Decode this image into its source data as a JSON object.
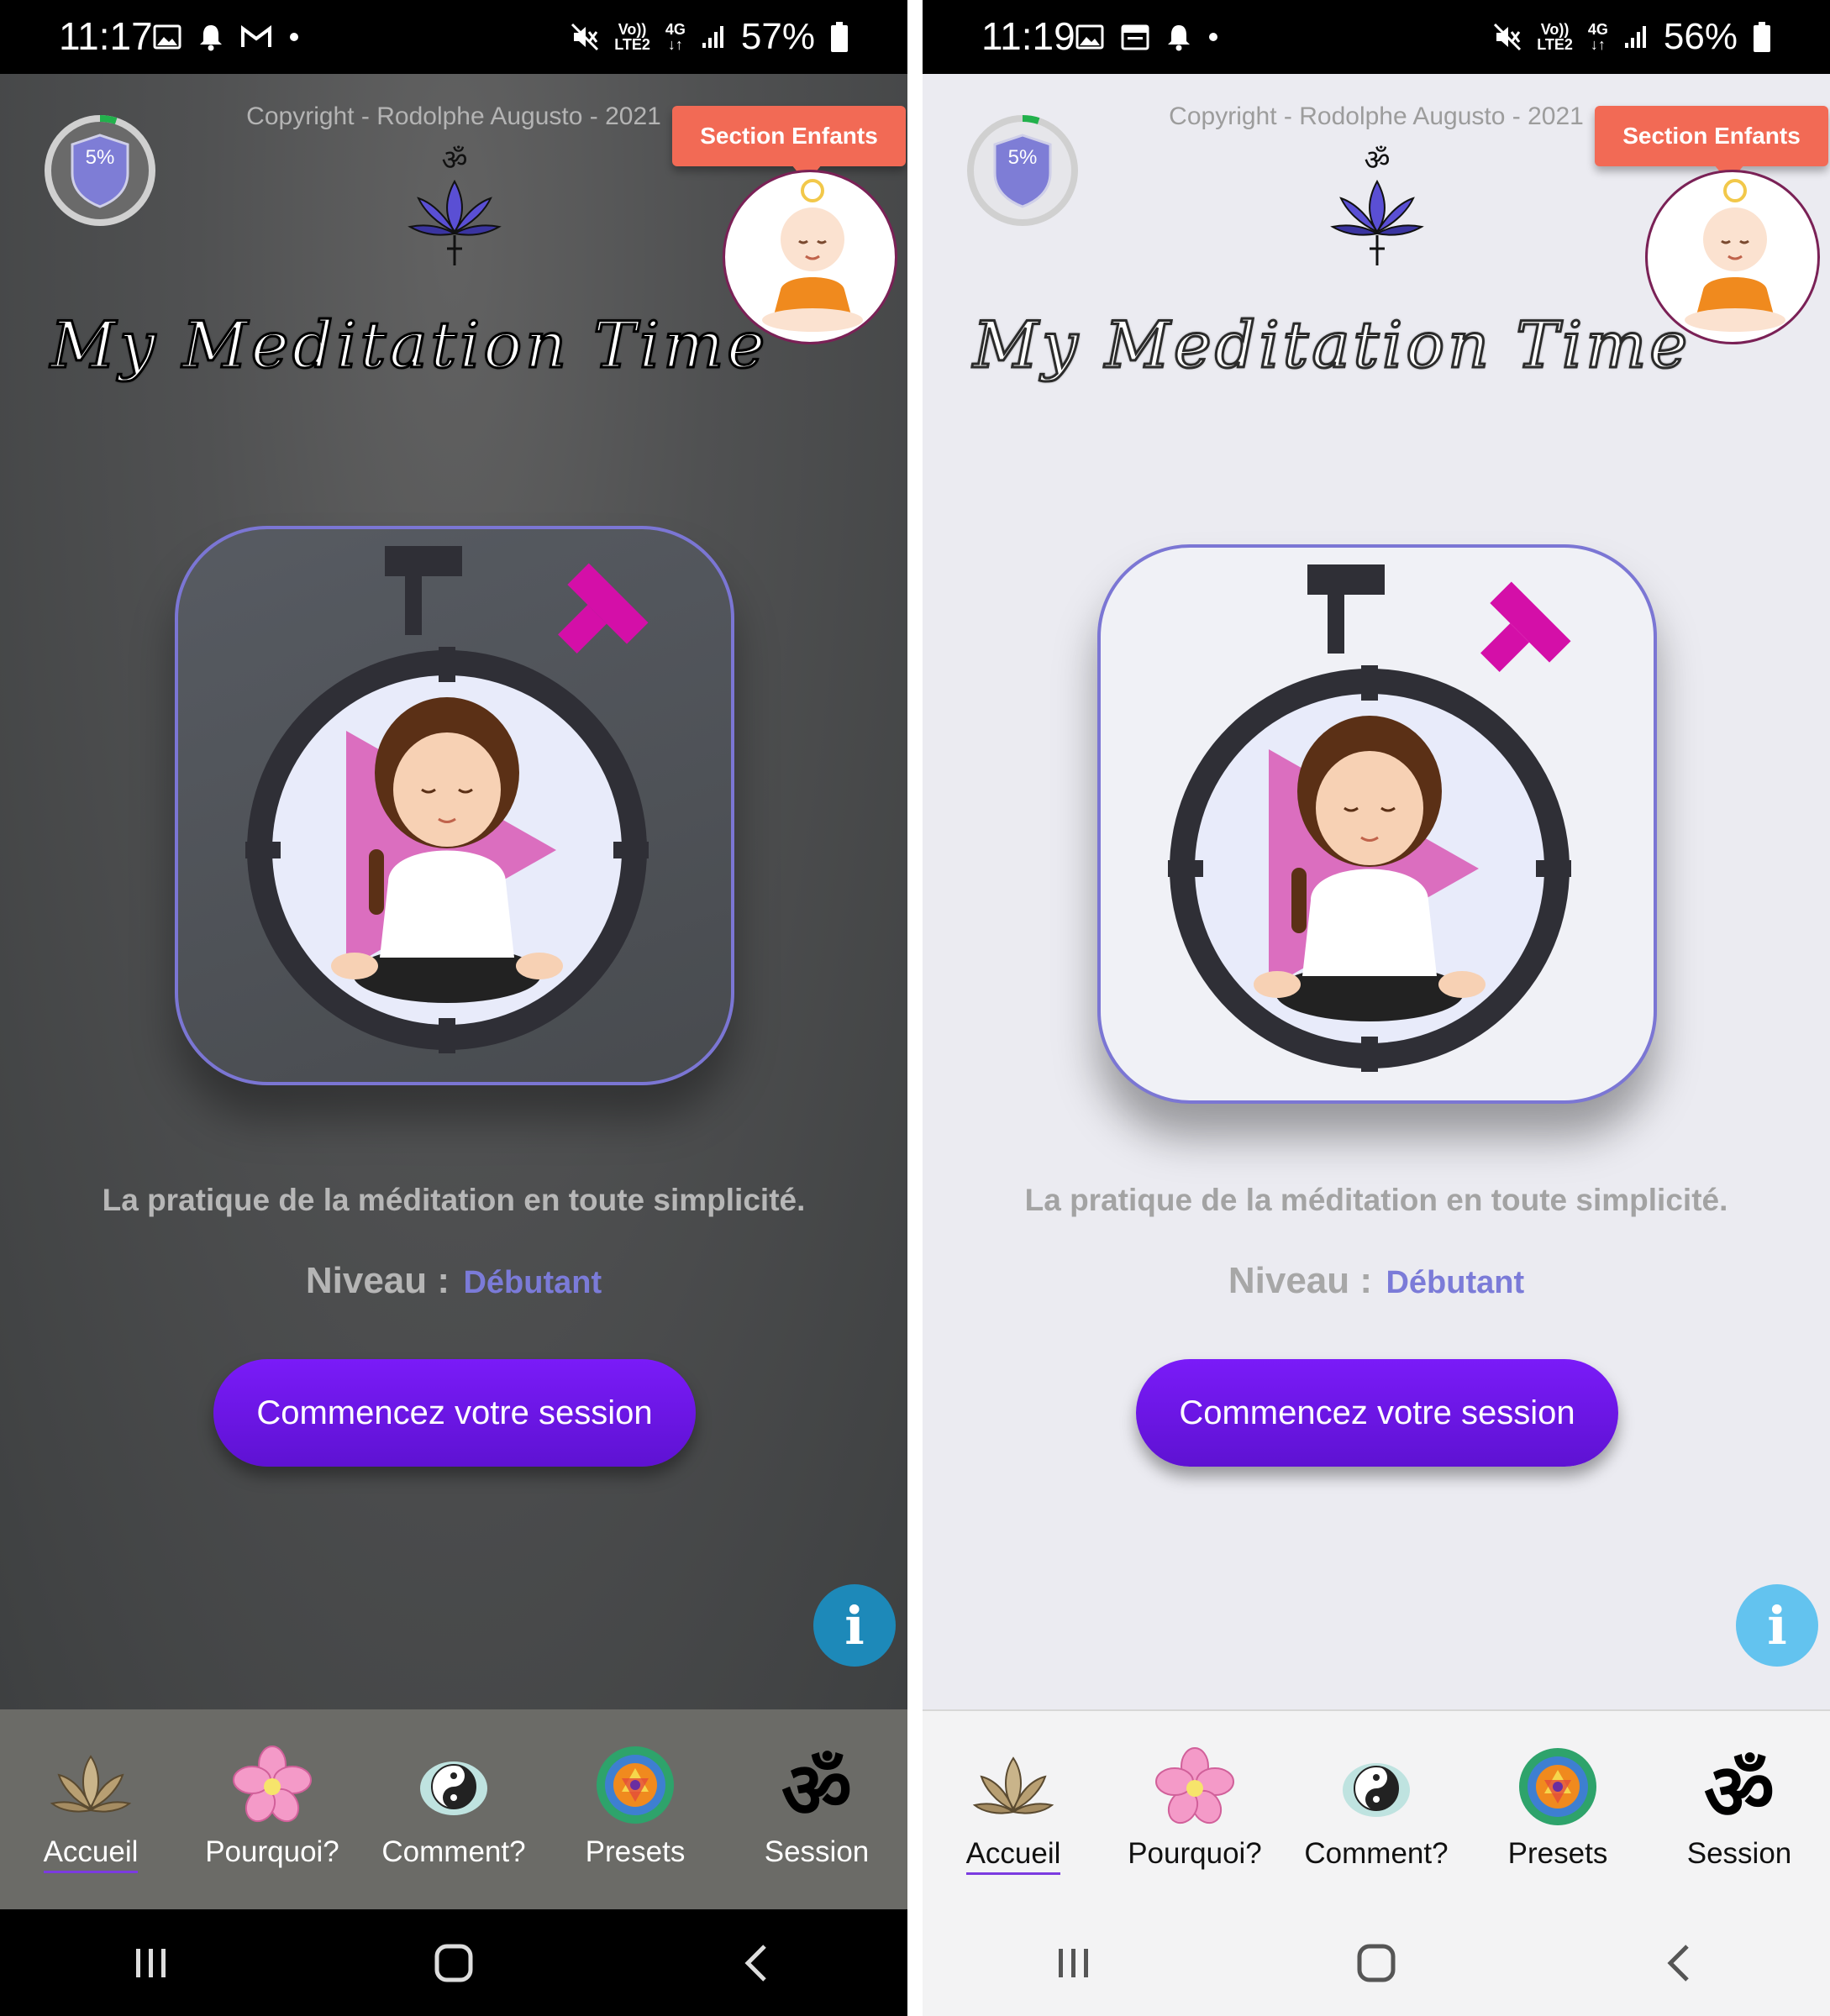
{
  "screens": [
    {
      "theme": "dark",
      "status": {
        "time": "11:17",
        "battery": "57%",
        "volte": "Vo))",
        "lte": "LTE2",
        "network": "4G"
      },
      "copyright": "Copyright - Rodolphe Augusto - 2021",
      "progress": {
        "label": "5%",
        "value": 0.05
      },
      "enfants_label": "Section Enfants",
      "title": "My Meditation Time",
      "tagline": "La pratique de la méditation en toute simplicité.",
      "niveau_label": "Niveau :",
      "niveau_value": "Débutant",
      "start_label": "Commencez votre session",
      "tabs": [
        {
          "label": "Accueil",
          "icon": "lotus-icon",
          "active": true
        },
        {
          "label": "Pourquoi?",
          "icon": "flower-icon",
          "active": false
        },
        {
          "label": "Comment?",
          "icon": "yin-yang-icon",
          "active": false
        },
        {
          "label": "Presets",
          "icon": "mandala-icon",
          "active": false
        },
        {
          "label": "Session",
          "icon": "om-icon",
          "active": false
        }
      ]
    },
    {
      "theme": "light",
      "status": {
        "time": "11:19",
        "battery": "56%",
        "volte": "Vo))",
        "lte": "LTE2",
        "network": "4G"
      },
      "copyright": "Copyright - Rodolphe Augusto - 2021",
      "progress": {
        "label": "5%",
        "value": 0.05
      },
      "enfants_label": "Section Enfants",
      "title": "My Meditation Time",
      "tagline": "La pratique de la méditation en toute simplicité.",
      "niveau_label": "Niveau :",
      "niveau_value": "Débutant",
      "start_label": "Commencez votre session",
      "tabs": [
        {
          "label": "Accueil",
          "icon": "lotus-icon",
          "active": true
        },
        {
          "label": "Pourquoi?",
          "icon": "flower-icon",
          "active": false
        },
        {
          "label": "Comment?",
          "icon": "yin-yang-icon",
          "active": false
        },
        {
          "label": "Presets",
          "icon": "mandala-icon",
          "active": false
        },
        {
          "label": "Session",
          "icon": "om-icon",
          "active": false
        }
      ]
    }
  ],
  "colors": {
    "accent": "#7b7bd8",
    "button": "#6a16e6",
    "enfants": "#f26a55",
    "progress": "#22b14c",
    "hero_border": "#7b76d4",
    "timer_pink": "#d40fa8"
  }
}
